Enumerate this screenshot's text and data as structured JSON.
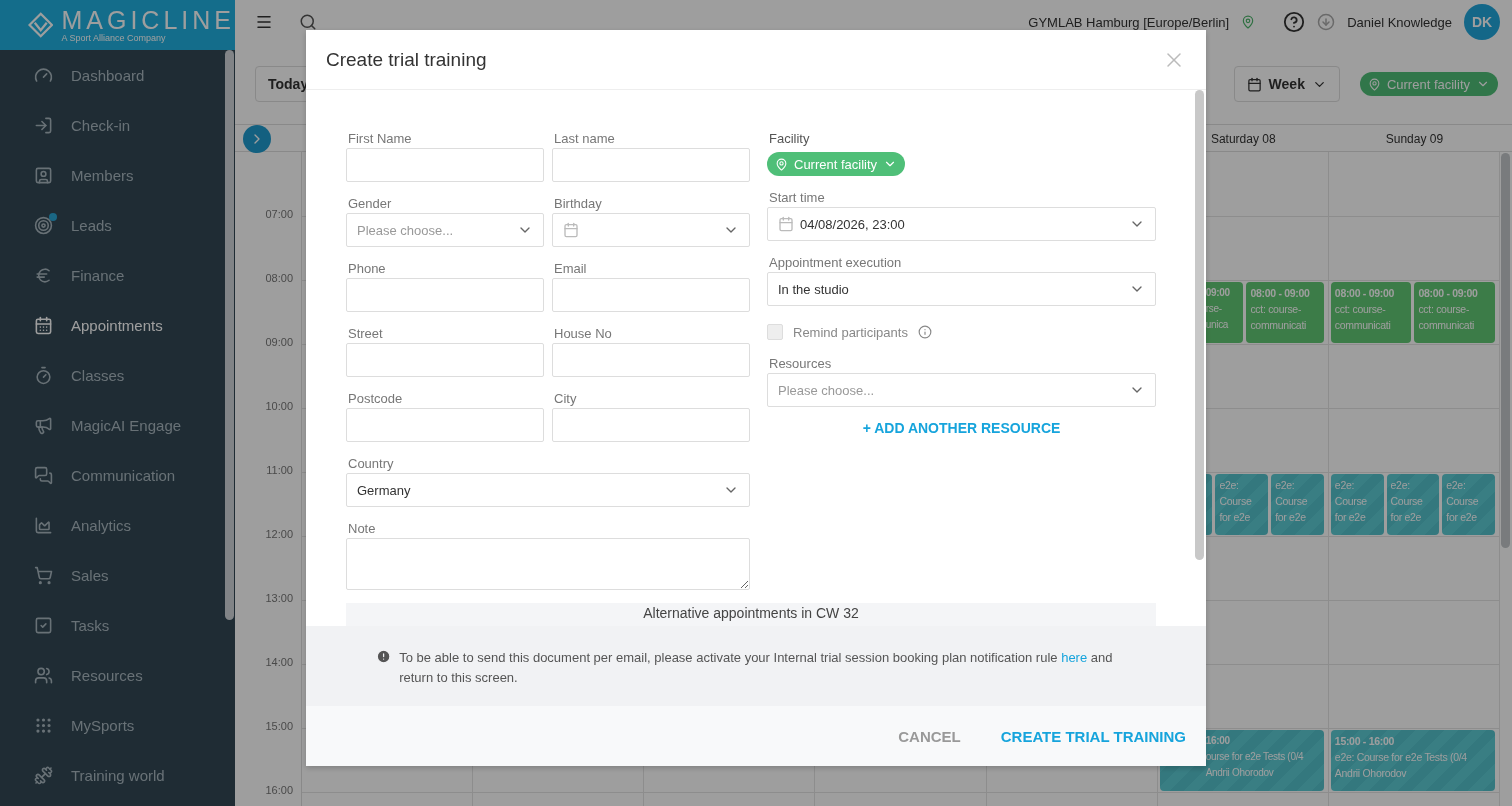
{
  "brand": {
    "name": "MAGICLINE",
    "tagline": "A Sport Alliance Company"
  },
  "sidebar": {
    "items": [
      {
        "label": "Dashboard",
        "selected": false,
        "notification": false
      },
      {
        "label": "Check-in",
        "selected": false,
        "notification": false
      },
      {
        "label": "Members",
        "selected": false,
        "notification": false
      },
      {
        "label": "Leads",
        "selected": false,
        "notification": true
      },
      {
        "label": "Finance",
        "selected": false,
        "notification": false
      },
      {
        "label": "Appointments",
        "selected": true,
        "notification": false
      },
      {
        "label": "Classes",
        "selected": false,
        "notification": false
      },
      {
        "label": "MagicAI Engage",
        "selected": false,
        "notification": false
      },
      {
        "label": "Communication",
        "selected": false,
        "notification": false
      },
      {
        "label": "Analytics",
        "selected": false,
        "notification": false
      },
      {
        "label": "Sales",
        "selected": false,
        "notification": false
      },
      {
        "label": "Tasks",
        "selected": false,
        "notification": false
      },
      {
        "label": "Resources",
        "selected": false,
        "notification": false
      },
      {
        "label": "MySports",
        "selected": false,
        "notification": false
      },
      {
        "label": "Training world",
        "selected": false,
        "notification": false
      }
    ]
  },
  "topbar": {
    "facility": "GYMLAB Hamburg [Europe/Berlin]",
    "user": "Daniel Knowledge",
    "initials": "DK"
  },
  "toolbar": {
    "today": "Today",
    "view": "Week",
    "facility": "Current facility"
  },
  "calendar": {
    "days": [
      {
        "label": "Saturday 08"
      },
      {
        "label": "Sunday 09"
      }
    ],
    "rows": [
      {
        "time": "07:00",
        "cells": [
          [],
          []
        ]
      },
      {
        "time": "08:00",
        "cells": [
          [
            {
              "kind": "class",
              "clipped": true,
              "time": "09:00",
              "lines": [
                "rse-",
                "unica"
              ]
            },
            {
              "kind": "class",
              "clipped": false,
              "time": "08:00 - 09:00",
              "lines": [
                "cct: course-",
                "communicati"
              ]
            }
          ],
          [
            {
              "kind": "class",
              "clipped": false,
              "time": "08:00 - 09:00",
              "lines": [
                "cct: course-",
                "communicati"
              ]
            },
            {
              "kind": "class",
              "clipped": false,
              "time": "08:00 - 09:00",
              "lines": [
                "cct: course-",
                "communicati"
              ]
            }
          ]
        ]
      },
      {
        "time": "09:00",
        "cells": [
          [],
          []
        ]
      },
      {
        "time": "10:00",
        "cells": [
          [],
          []
        ]
      },
      {
        "time": "11:00",
        "cells": [
          [
            {
              "kind": "course"
            },
            {
              "kind": "course",
              "clipped": false,
              "lines": [
                "e2e:",
                "Course",
                "for e2e"
              ]
            },
            {
              "kind": "course",
              "clipped": false,
              "lines": [
                "e2e:",
                "Course",
                "for e2e"
              ]
            }
          ],
          [
            {
              "kind": "course",
              "clipped": false,
              "lines": [
                "e2e:",
                "Course",
                "for e2e"
              ]
            },
            {
              "kind": "course",
              "clipped": false,
              "lines": [
                "e2e:",
                "Course",
                "for e2e"
              ]
            },
            {
              "kind": "course",
              "clipped": false,
              "lines": [
                "e2e:",
                "Course",
                "for e2e"
              ]
            }
          ]
        ]
      },
      {
        "time": "12:00",
        "cells": [
          [],
          []
        ]
      },
      {
        "time": "13:00",
        "cells": [
          [],
          []
        ]
      },
      {
        "time": "14:00",
        "cells": [
          [],
          []
        ]
      },
      {
        "time": "15:00",
        "cells": [
          [
            {
              "kind": "course",
              "clipped": true,
              "time": "16:00",
              "lines": [
                "ourse for e2e Tests (0/4",
                "Andrii Ohorodov"
              ]
            }
          ],
          [
            {
              "kind": "course",
              "clipped": false,
              "time": "15:00 - 16:00",
              "lines": [
                "e2e: Course for e2e Tests (0/4",
                "Andrii Ohorodov"
              ]
            }
          ]
        ]
      },
      {
        "time": "16:00",
        "cells": [
          [],
          []
        ]
      }
    ]
  },
  "modal": {
    "title": "Create trial training",
    "left": [
      {
        "kind": "text",
        "label": "First Name",
        "wide": false
      },
      {
        "kind": "text",
        "label": "Last name",
        "wide": false
      },
      {
        "kind": "select",
        "label": "Gender",
        "placeholder": "Please choose...",
        "wide": false
      },
      {
        "kind": "date",
        "label": "Birthday",
        "wide": false
      },
      {
        "kind": "text",
        "label": "Phone",
        "wide": false
      },
      {
        "kind": "text",
        "label": "Email",
        "wide": false
      },
      {
        "kind": "text",
        "label": "Street",
        "wide": false
      },
      {
        "kind": "text",
        "label": "House No",
        "wide": false
      },
      {
        "kind": "text",
        "label": "Postcode",
        "wide": false
      },
      {
        "kind": "text",
        "label": "City",
        "wide": false
      },
      {
        "kind": "select",
        "label": "Country",
        "value": "Germany",
        "wide": true
      },
      {
        "kind": "textarea",
        "label": "Note",
        "wide": true
      }
    ],
    "facility": {
      "label": "Facility",
      "value": "Current facility"
    },
    "right": [
      {
        "kind": "date",
        "label": "Start time",
        "value": "04/08/2026, 23:00"
      },
      {
        "kind": "select",
        "label": "Appointment execution",
        "value": "In the studio"
      }
    ],
    "remind": {
      "label": "Remind participants",
      "checked": false,
      "disabled": true
    },
    "resources": {
      "label": "Resources",
      "placeholder": "Please choose..."
    },
    "add_resource": "+ ADD ANOTHER RESOURCE",
    "alternatives": "Alternative appointments in CW 32",
    "notice": {
      "before": "To be able to send this document per email, please activate your Internal trial session booking plan notification rule",
      "link": "here",
      "after": "and return to this screen."
    },
    "cancel": "CANCEL",
    "submit": "CREATE TRIAL TRAINING"
  }
}
